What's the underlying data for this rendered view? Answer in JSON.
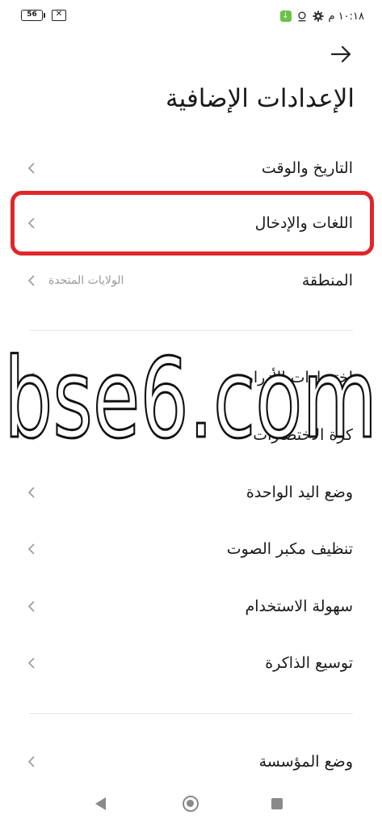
{
  "status_bar": {
    "time": "١٠:١٨ م",
    "battery_level": "56",
    "icons": [
      "green-download-icon",
      "location-icon",
      "settings-gear-icon",
      "sim-disabled-icon"
    ]
  },
  "header": {
    "title": "الإعدادات الإضافية",
    "back_icon": "arrow-right-icon"
  },
  "settings": {
    "items": [
      {
        "label": "التاريخ والوقت",
        "value": ""
      },
      {
        "label": "اللغات والإدخال",
        "value": ""
      },
      {
        "label": "المنطقة",
        "value": "الولايات المتحدة"
      },
      {
        "label": "اختصارات الأزرار",
        "value": ""
      },
      {
        "label": "كرة الاختصارات",
        "value": ""
      },
      {
        "label": "وضع اليد الواحدة",
        "value": ""
      },
      {
        "label": "تنظيف مكبر الصوت",
        "value": ""
      },
      {
        "label": "سهولة الاستخدام",
        "value": ""
      },
      {
        "label": "توسيع الذاكرة",
        "value": ""
      },
      {
        "label": "وضع المؤسسة",
        "value": ""
      }
    ]
  },
  "watermark": {
    "text": "bse6.com"
  },
  "highlight_color": "#e0262a",
  "nav_bar": {
    "icons": [
      "back-triangle-icon",
      "home-circle-icon",
      "recents-square-icon"
    ]
  }
}
